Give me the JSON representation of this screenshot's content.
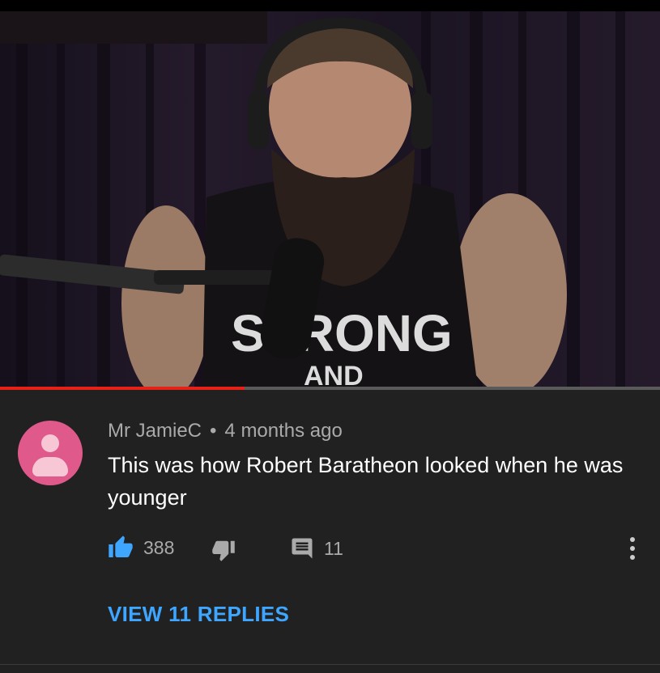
{
  "video": {
    "shirt_text_top": "STRONG",
    "shirt_text_bottom": "AND",
    "progress_fraction": 0.37,
    "progress_color": "#e62117"
  },
  "comment": {
    "author": "Mr JamieC",
    "separator": "•",
    "time": "4 months ago",
    "text": "This was how Robert Baratheon looked when he was younger",
    "avatar_color": "#e0598b",
    "like_count": "388",
    "reply_count": "11",
    "view_replies": "VIEW 11 REPLIES",
    "accent": "#3ea6ff"
  },
  "icons": {
    "like": "thumbs-up-icon",
    "dislike": "thumbs-down-icon",
    "reply": "comment-icon",
    "more": "more-vert-icon"
  }
}
